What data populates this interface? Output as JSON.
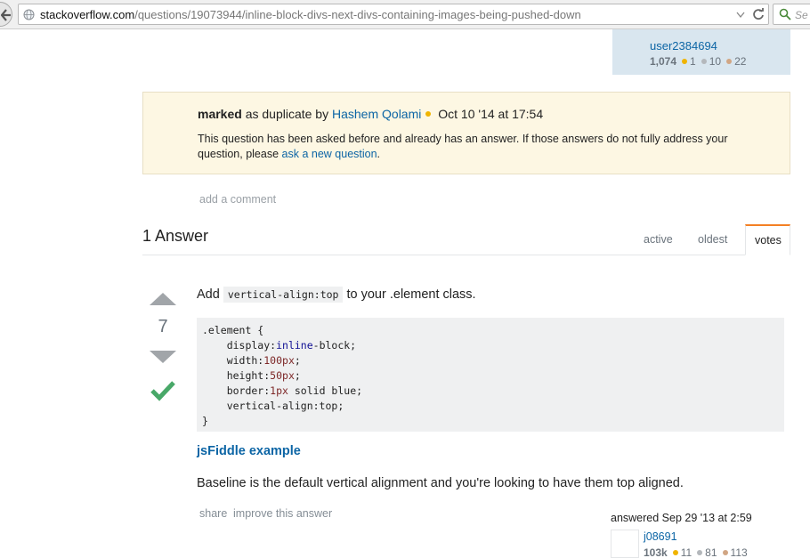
{
  "browser": {
    "url_domain": "stackoverflow.com",
    "url_path": "/questions/19073944/inline-block-divs-next-divs-containing-images-being-pushed-down",
    "search_placeholder": "Se"
  },
  "owner": {
    "name": "user2384694",
    "rep": "1,074",
    "gold": "1",
    "silver": "10",
    "bronze": "22"
  },
  "duplicate": {
    "marked": "marked",
    "as_duplicate_by": "as duplicate by",
    "user": "Hashem Qolami",
    "date": "Oct 10 '14 at 17:54",
    "body_text": "This question has been asked before and already has an answer. If those answers do not fully address your question, please",
    "link": "ask a new question",
    "period": "."
  },
  "comments": {
    "add_comment": "add a comment"
  },
  "answers_header": {
    "title": "1 Answer",
    "tabs": [
      "active",
      "oldest",
      "votes"
    ]
  },
  "answer": {
    "votes": "7",
    "intro_before": "Add",
    "intro_code": "vertical-align:top",
    "intro_after": "to your .element class.",
    "code_lines": [
      ".element {",
      "    display:inline-block;",
      "    width:100px;",
      "    height:50px;",
      "    border:1px solid blue;",
      "    vertical-align:top;",
      "}"
    ],
    "fiddle": "jsFiddle example",
    "conclusion": "Baseline is the default vertical alignment and you're looking to have them top aligned.",
    "menu": [
      "share",
      "improve this answer"
    ],
    "answered_label": "answered Sep 29 '13 at 2:59",
    "answerer": {
      "name": "j08691",
      "rep": "103k",
      "gold": "11",
      "silver": "81",
      "bronze": "113"
    }
  },
  "colors": {
    "link": "#0c65a5",
    "notice_bg": "#fdf7e3",
    "accepted": "#48a868",
    "active_tab_accent": "#f48024"
  }
}
